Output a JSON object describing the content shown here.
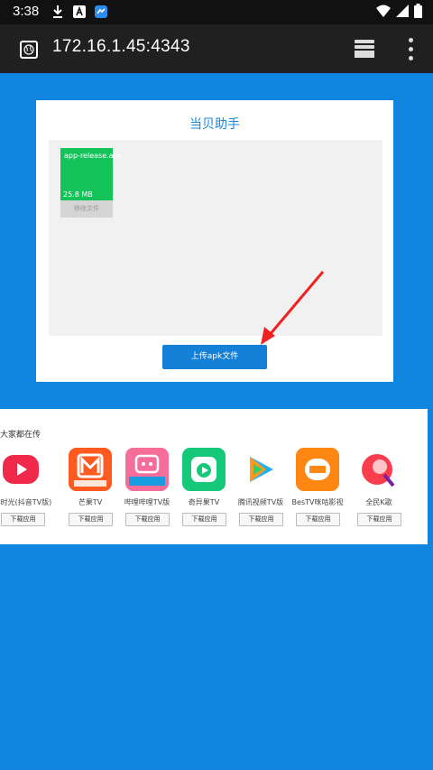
{
  "status_bar": {
    "time": "3:38",
    "icons": [
      "download-icon",
      "a-notification-icon",
      "messenger-icon",
      "wifi-icon",
      "signal-icon",
      "battery-icon"
    ]
  },
  "browser": {
    "url": "172.16.1.45:4343",
    "icons": [
      "site-info-icon",
      "tabs-icon",
      "overflow-menu-icon"
    ]
  },
  "upload_card": {
    "title": "当贝助手",
    "file": {
      "name": "app-release.apk",
      "size": "25.8 MB",
      "remove_label": "移除文件"
    },
    "upload_button": "上传apk文件"
  },
  "apps_section": {
    "title": "大家都在传",
    "download_label": "下载应用",
    "apps": [
      {
        "name": "鲜时光(抖音TV版)",
        "icon": "xianshiguang-icon"
      },
      {
        "name": "芒果TV",
        "icon": "mangotv-icon"
      },
      {
        "name": "哔哩哔哩TV版",
        "icon": "bilibili-icon"
      },
      {
        "name": "奇异果TV",
        "icon": "qiyiguo-icon"
      },
      {
        "name": "腾讯视频TV版",
        "icon": "tencent-video-icon"
      },
      {
        "name": "BesTV咪咕影视",
        "icon": "bestv-icon"
      },
      {
        "name": "全民K歌",
        "icon": "quanmin-kge-icon"
      }
    ]
  },
  "colors": {
    "page_background": "#0f85e0",
    "accent": "#1580d8",
    "file_tile": "#14c45b"
  }
}
